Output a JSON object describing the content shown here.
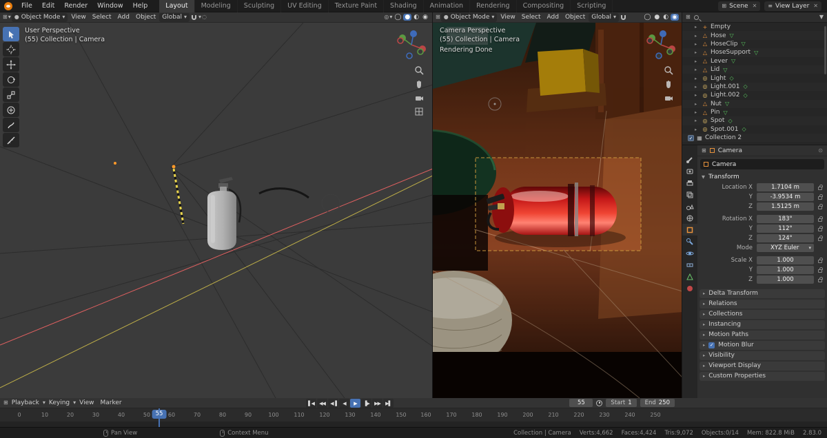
{
  "icons": {
    "dropdown": "▾",
    "right_arrow": "▸",
    "down_arrow": "▼",
    "editor": "⊞",
    "mode_sphere": "●",
    "mesh_object": "△",
    "light_object": "◎",
    "empty_object": "+",
    "collection": "▦",
    "mesh_data": "▽",
    "light_data": "◇",
    "check": "✓",
    "sphere_wire": "◯",
    "sphere_solid": "●",
    "sphere_material": "◐",
    "sphere_rendered": "◉",
    "proportional": "◌",
    "overlays": "◎",
    "layers": "≡",
    "pin": "⊙",
    "jump_start": "▌◀",
    "key_prev": "◀◀",
    "frame_prev": "◀▐",
    "play_back": "◀",
    "play": "▶",
    "frame_next": "▐▶",
    "key_next": "▶▶",
    "jump_end": "▶▌"
  },
  "topbar": {
    "menus": [
      "File",
      "Edit",
      "Render",
      "Window",
      "Help"
    ],
    "workspaces": [
      "Layout",
      "Modeling",
      "Sculpting",
      "UV Editing",
      "Texture Paint",
      "Shading",
      "Animation",
      "Rendering",
      "Compositing",
      "Scripting"
    ],
    "active_workspace": "Layout",
    "scene": "Scene",
    "view_layer": "View Layer"
  },
  "viewport_left": {
    "mode": "Object Mode",
    "menus": [
      "View",
      "Select",
      "Add",
      "Object"
    ],
    "orientation": "Global",
    "overlay_line1": "User Perspective",
    "overlay_line2": "(55) Collection | Camera"
  },
  "viewport_right": {
    "mode": "Object Mode",
    "menus": [
      "View",
      "Select",
      "Add",
      "Object"
    ],
    "orientation": "Global",
    "overlay_line1": "Camera Perspective",
    "overlay_line2": "(55) Collection | Camera",
    "overlay_line3": "Rendering Done"
  },
  "outliner": {
    "items": [
      {
        "label": "Empty"
      },
      {
        "label": "Hose"
      },
      {
        "label": "HoseClip"
      },
      {
        "label": "HoseSupport"
      },
      {
        "label": "Lever"
      },
      {
        "label": "Lid"
      },
      {
        "label": "Light"
      },
      {
        "label": "Light.001"
      },
      {
        "label": "Light.002"
      },
      {
        "label": "Nut"
      },
      {
        "label": "Pin"
      },
      {
        "label": "Spot"
      },
      {
        "label": "Spot.001"
      },
      {
        "label": "Collection 2"
      }
    ]
  },
  "properties": {
    "breadcrumb": "Camera",
    "name_field": "Camera",
    "transform_title": "Transform",
    "rows": {
      "loc_x_label": "Location X",
      "loc_x": "1.7104 m",
      "loc_y_label": "Y",
      "loc_y": "-3.9534 m",
      "loc_z_label": "Z",
      "loc_z": "1.5125 m",
      "rot_x_label": "Rotation X",
      "rot_x": "183°",
      "rot_y_label": "Y",
      "rot_y": "112°",
      "rot_z_label": "Z",
      "rot_z": "124°",
      "mode_label": "Mode",
      "mode": "XYZ Euler",
      "scale_x_label": "Scale X",
      "scale_x": "1.000",
      "scale_y_label": "Y",
      "scale_y": "1.000",
      "scale_z_label": "Z",
      "scale_z": "1.000"
    },
    "sections": [
      "Delta Transform",
      "Relations",
      "Collections",
      "Instancing",
      "Motion Paths",
      "Motion Blur",
      "Visibility",
      "Viewport Display",
      "Custom Properties"
    ]
  },
  "timeline": {
    "menus": [
      "Playback",
      "Keying",
      "View",
      "Marker"
    ],
    "current_frame": "55",
    "start_label": "Start",
    "start_value": "1",
    "end_label": "End",
    "end_value": "250",
    "ticks": [
      "0",
      "10",
      "20",
      "30",
      "40",
      "50",
      "60",
      "70",
      "80",
      "90",
      "100",
      "110",
      "120",
      "130",
      "140",
      "150",
      "160",
      "170",
      "180",
      "190",
      "200",
      "210",
      "220",
      "230",
      "240",
      "250"
    ]
  },
  "statusbar": {
    "hint_pan": "Pan View",
    "hint_context": "Context Menu",
    "stats": [
      "Collection | Camera",
      "Verts:4,662",
      "Faces:4,424",
      "Tris:9,072",
      "Objects:0/14",
      "Mem: 822.8 MiB",
      "2.83.0"
    ]
  },
  "colors": {
    "accent_blue": "#4772b3",
    "object_orange": "#e8923c",
    "data_green": "#58c55e"
  }
}
